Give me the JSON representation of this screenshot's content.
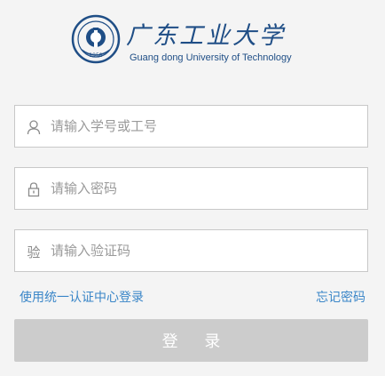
{
  "header": {
    "logo_cn": "广东工业大学",
    "logo_en": "Guang dong University of Technology",
    "emblem_text": "1958"
  },
  "form": {
    "username_placeholder": "请输入学号或工号",
    "password_placeholder": "请输入密码",
    "captcha_icon_label": "验",
    "captcha_placeholder": "请输入验证码",
    "unified_auth_link": "使用统一认证中心登录",
    "forgot_password_link": "忘记密码",
    "login_button": "登 录"
  },
  "colors": {
    "brand": "#1f4e86",
    "link": "#3a86c8",
    "button_disabled": "#cccccc"
  },
  "icons": {
    "username": "user-icon",
    "password": "lock-icon",
    "emblem": "university-emblem"
  }
}
